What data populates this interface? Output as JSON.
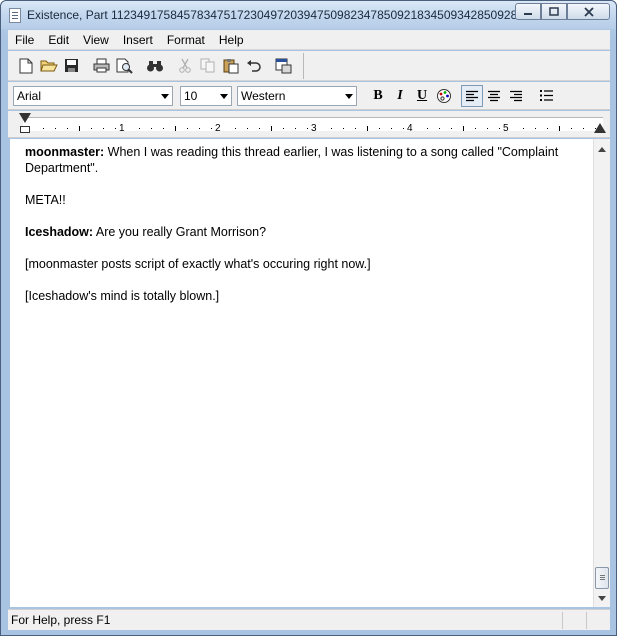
{
  "window": {
    "title": "Existence, Part 1123491758457834751723049720394750982347850921834509342850928..."
  },
  "menu": [
    "File",
    "Edit",
    "View",
    "Insert",
    "Format",
    "Help"
  ],
  "toolbar": {
    "icons": [
      "new-document",
      "open",
      "save",
      "print",
      "print-preview",
      "find",
      "cut",
      "copy",
      "paste",
      "undo",
      "insert-object"
    ]
  },
  "format": {
    "font": "Arial",
    "size": "10",
    "script": "Western",
    "bold": "B",
    "italic": "I",
    "underline": "U"
  },
  "ruler": {
    "numbers": [
      "1",
      "2",
      "3",
      "4",
      "5"
    ]
  },
  "document": {
    "paragraphs": [
      {
        "speaker": "moonmaster:",
        "text": " When I was reading this thread earlier, I was listening to a song called \"Complaint Department\"."
      },
      {
        "speaker": "",
        "text": "META!!"
      },
      {
        "speaker": "Iceshadow:",
        "text": " Are you really Grant Morrison?"
      },
      {
        "speaker": "",
        "text": "[moonmaster posts script of exactly what's occuring right now.]"
      },
      {
        "speaker": "",
        "text": "[Iceshadow's mind is totally blown.]"
      }
    ]
  },
  "status": {
    "text": "For Help, press F1"
  }
}
